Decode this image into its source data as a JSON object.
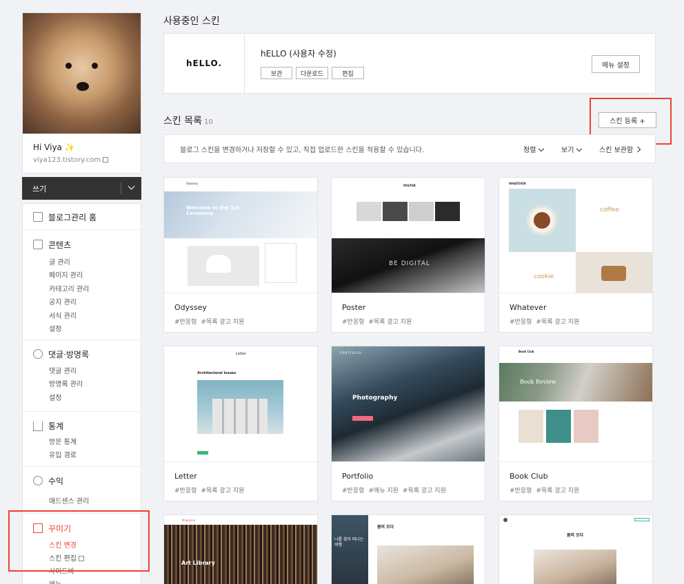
{
  "profile": {
    "greeting": "Hi Viya ✨",
    "url": "viya123.tistory.com"
  },
  "write": {
    "label": "쓰기"
  },
  "menu": {
    "home": "블로그관리 홈",
    "content": {
      "title": "콘텐츠",
      "items": [
        "글 관리",
        "페이지 관리",
        "카테고리 관리",
        "공지 관리",
        "서식 관리",
        "설정"
      ]
    },
    "comments": {
      "title": "댓글·방명록",
      "items": [
        "댓글 관리",
        "방명록 관리",
        "설정"
      ]
    },
    "stats": {
      "title": "통계",
      "items": [
        "방문 통계",
        "유입 경로"
      ]
    },
    "revenue": {
      "title": "수익",
      "items": [
        "애드센스 관리"
      ]
    },
    "decorate": {
      "title": "꾸미기",
      "items": [
        "스킨 변경",
        "스킨 편집",
        "사이드바",
        "메뉴"
      ]
    }
  },
  "main": {
    "using_title": "사용중인 스킨",
    "current_skin": {
      "logo": "hELLO.",
      "name": "hELLO (사용자 수정)",
      "buttons": [
        "보관",
        "다운로드",
        "편집"
      ],
      "menu_settings": "메뉴 설정"
    },
    "list_title": "스킨 목록",
    "list_count": "10",
    "register": "스킨 등록 +",
    "info": "블로그 스킨을 변경하거나 저장할 수 있고, 직접 업로드한 스킨을 적용할 수 있습니다.",
    "sort": "정렬",
    "view": "보기",
    "storage": "스킨 보관함"
  },
  "skins": [
    {
      "name": "Odyssey",
      "tags": [
        "#반응형",
        "#목록 광고 지원"
      ],
      "text1": "Odyssey",
      "text2": "Welcome to the 1st Ceremony"
    },
    {
      "name": "Poster",
      "tags": [
        "#반응형",
        "#목록 광고 지원"
      ],
      "text1": "POSTER",
      "text2": "BE DIGITAL"
    },
    {
      "name": "Whatever",
      "tags": [
        "#반응형",
        "#목록 광고 지원"
      ],
      "text1": "WHATEVER",
      "text2": "coffee",
      "text3": "cookie"
    },
    {
      "name": "Letter",
      "tags": [
        "#반응형",
        "#목록 광고 지원"
      ],
      "text1": "Letter",
      "text2": "Architectural Issues"
    },
    {
      "name": "Portfolio",
      "tags": [
        "#반응형",
        "#메뉴 지원",
        "#목록 광고 지원"
      ],
      "text1": "PORTFOLIO",
      "text2": "Photography"
    },
    {
      "name": "Book Club",
      "tags": [
        "#반응형",
        "#목록 광고 지원"
      ],
      "text1": "Book Club",
      "text2": "Book Review"
    },
    {
      "name": "",
      "tags": [],
      "text1": "Magazine",
      "text2": "Art Library"
    },
    {
      "name": "",
      "tags": [],
      "text1": "나를 찾아 떠나는 여행",
      "text2": "봄의 오다"
    },
    {
      "name": "",
      "tags": [],
      "text1": "봄의 오다"
    }
  ],
  "colors": {
    "accent": "#ee3f33",
    "dark": "#333333"
  }
}
